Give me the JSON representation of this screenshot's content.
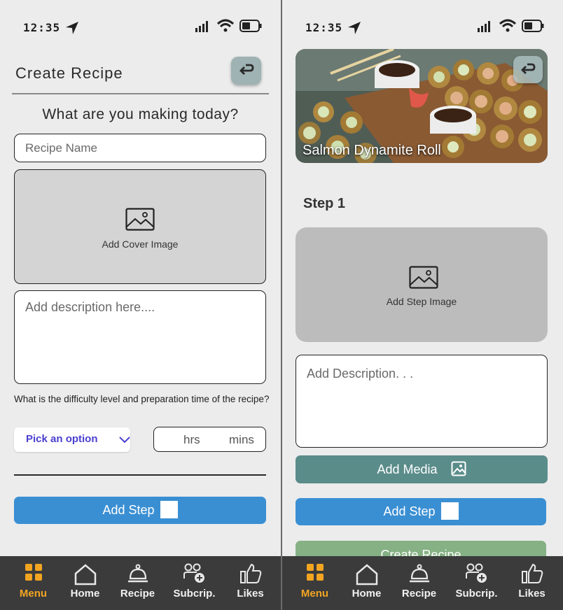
{
  "status_bar": {
    "time": "12:35"
  },
  "create_screen": {
    "title": "Create Recipe",
    "question": "What are you making today?",
    "recipe_name_placeholder": "Recipe Name",
    "cover_image_label": "Add Cover Image",
    "description_placeholder": "Add description here....",
    "difficulty_question": "What is the difficulty level and preparation time of the recipe?",
    "pick_option_label": "Pick an option",
    "hrs_label": "hrs",
    "mins_label": "mins",
    "add_step_label": "Add Step"
  },
  "step_screen": {
    "recipe_title": "Salmon Dynamite Roll",
    "step_heading": "Step 1",
    "step_image_label": "Add Step Image",
    "description_placeholder": "Add Description. . .",
    "add_media_label": "Add Media",
    "add_step_label": "Add Step",
    "create_recipe_label": "Create Recipe"
  },
  "tab_bar": {
    "items": [
      {
        "label": "Menu",
        "icon": "grid-icon",
        "active": true
      },
      {
        "label": "Home",
        "icon": "home-icon",
        "active": false
      },
      {
        "label": "Recipe",
        "icon": "cloche-icon",
        "active": false
      },
      {
        "label": "Subcrip.",
        "icon": "add-user-icon",
        "active": false
      },
      {
        "label": "Likes",
        "icon": "thumbs-up-icon",
        "active": false
      }
    ]
  },
  "colors": {
    "accent_orange": "#f2a521",
    "button_blue": "#3a8fd3",
    "button_teal": "#5a8c8a",
    "button_green": "#85b184",
    "link_purple": "#4a3fd0",
    "tab_bar_bg": "#3b3b3b"
  }
}
